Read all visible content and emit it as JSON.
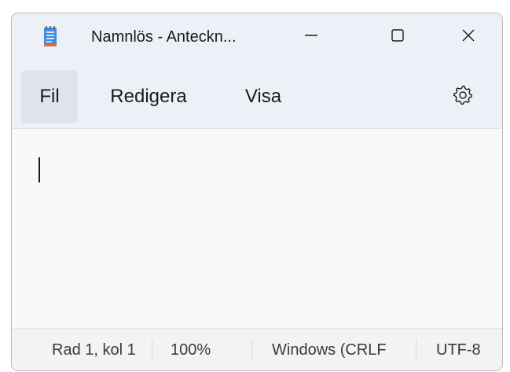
{
  "window": {
    "title": "Namnlös - Anteckn..."
  },
  "icons": {
    "app": "notepad-icon",
    "minimize": "minimize-icon",
    "maximize": "maximize-icon",
    "close": "close-icon",
    "settings": "gear-icon"
  },
  "menu": {
    "items": [
      {
        "label": "Fil"
      },
      {
        "label": "Redigera"
      },
      {
        "label": "Visa"
      }
    ]
  },
  "editor": {
    "text": ""
  },
  "status": {
    "position": "Rad 1, kol 1",
    "zoom": "100%",
    "line_ending": "Windows (CRLF",
    "encoding": "UTF-8"
  },
  "colors": {
    "titlebar_bg": "#eef0f8",
    "active_menu_bg": "#e1e3ec",
    "editor_bg": "#f9f9f9",
    "statusbar_bg": "#f3f3f3"
  }
}
